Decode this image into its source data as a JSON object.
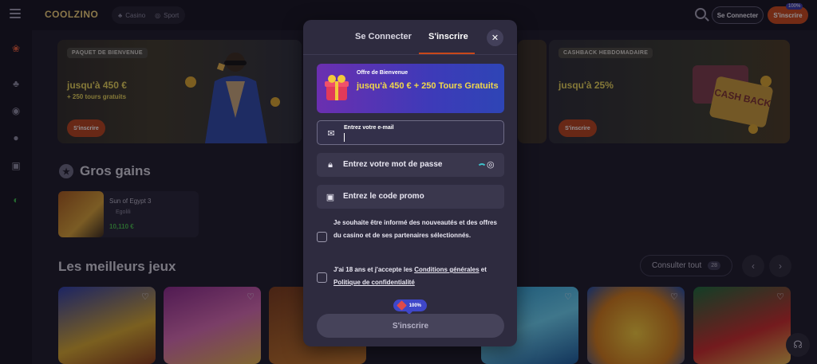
{
  "header": {
    "logo": "COOLZINO",
    "nav": [
      "Casino",
      "Sport"
    ],
    "login_label": "Se Connecter",
    "signup_label": "S'inscrire",
    "signup_badge": "100%"
  },
  "rail": {
    "icons": [
      "slots-icon",
      "cherries-icon",
      "live-icon",
      "football-icon",
      "gamepad-icon",
      "headset-icon"
    ]
  },
  "promos": [
    {
      "tag": "PAQUET DE BIENVENUE",
      "amount": "jusqu'à 450 €",
      "sub": "+ 250 tours gratuits",
      "button": "S'inscrire"
    },
    {
      "tag": "CASHBACK HEBDOMADAIRE",
      "amount": "jusqu'à 25%",
      "button": "S'inscrire",
      "art_text": "CASH BACK"
    }
  ],
  "big_wins": {
    "title": "Gros gains",
    "items": [
      {
        "game": "Sun of Egypt 3",
        "user": "Egolili",
        "amount": "10,110 €"
      }
    ]
  },
  "best_games": {
    "title": "Les meilleurs jeux",
    "see_all_label": "Consulter tout",
    "count": "28",
    "prev": "‹",
    "next": "›"
  },
  "modal": {
    "tab_login": "Se Connecter",
    "tab_signup": "S'inscrire",
    "close": "✕",
    "offer": {
      "kicker": "Offre de Bienvenue",
      "title": "jusqu'à 450 € + 250 Tours Gratuits"
    },
    "email": {
      "label": "Entrez votre e-mail",
      "value": ""
    },
    "password": {
      "placeholder": "Entrez votre mot de passe"
    },
    "promo": {
      "placeholder": "Entrez le code promo"
    },
    "consent_news": "Je souhaite être informé des nouveautés et des offres du casino et de ses partenaires sélectionnés.",
    "consent_terms_prefix": "J'ai 18 ans et j'accepte les ",
    "consent_terms_link1": "Conditions générales",
    "consent_terms_mid": " et ",
    "consent_terms_link2": "Politique de confidentialité",
    "badge": "100%",
    "submit_label": "S'inscrire"
  }
}
